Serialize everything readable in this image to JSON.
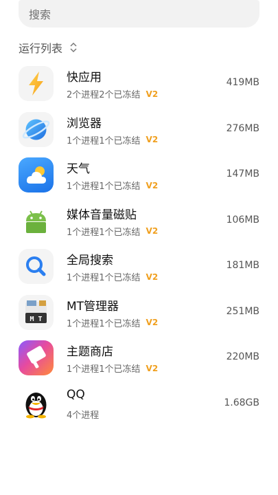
{
  "search": {
    "placeholder": "搜索"
  },
  "section": {
    "title": "运行列表"
  },
  "apps": [
    {
      "name": "快应用",
      "subtitle": "2个进程2个已冻结",
      "badge": "V2",
      "size": "419MB",
      "icon": "quick-app-icon"
    },
    {
      "name": "浏览器",
      "subtitle": "1个进程1个已冻结",
      "badge": "V2",
      "size": "276MB",
      "icon": "browser-icon"
    },
    {
      "name": "天气",
      "subtitle": "1个进程1个已冻结",
      "badge": "V2",
      "size": "147MB",
      "icon": "weather-icon"
    },
    {
      "name": "媒体音量磁贴",
      "subtitle": "1个进程1个已冻结",
      "badge": "V2",
      "size": "106MB",
      "icon": "android-icon"
    },
    {
      "name": "全局搜索",
      "subtitle": "1个进程1个已冻结",
      "badge": "V2",
      "size": "181MB",
      "icon": "global-search-icon"
    },
    {
      "name": "MT管理器",
      "subtitle": "1个进程1个已冻结",
      "badge": "V2",
      "size": "251MB",
      "icon": "mt-manager-icon"
    },
    {
      "name": "主题商店",
      "subtitle": "1个进程1个已冻结",
      "badge": "V2",
      "size": "220MB",
      "icon": "theme-store-icon"
    },
    {
      "name": "QQ",
      "subtitle": "4个进程",
      "badge": "",
      "size": "1.68GB",
      "icon": "qq-penguin-icon"
    }
  ],
  "colors": {
    "badge": "#f0a020",
    "search_bg": "#f2f2f2"
  }
}
